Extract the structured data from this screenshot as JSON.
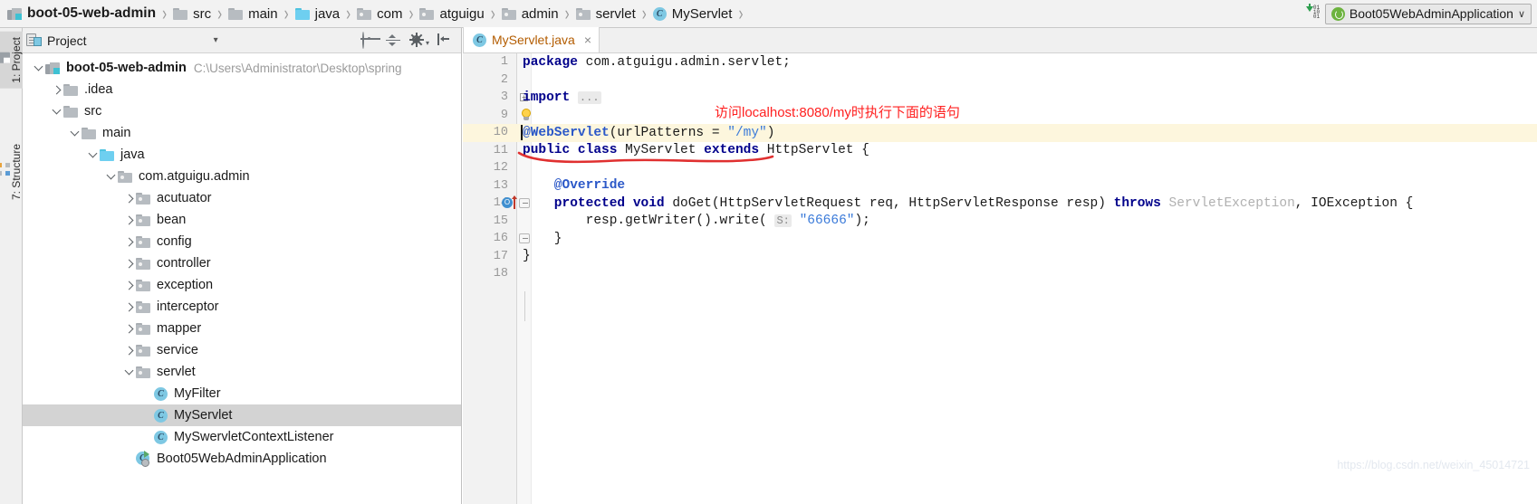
{
  "navbar": {
    "breadcrumbs": [
      {
        "label": "boot-05-web-admin",
        "icon": "module-icon",
        "kind": "module"
      },
      {
        "label": "src",
        "icon": "folder-icon",
        "kind": "folder"
      },
      {
        "label": "main",
        "icon": "folder-icon",
        "kind": "folder"
      },
      {
        "label": "java",
        "icon": "source-folder-icon",
        "kind": "source"
      },
      {
        "label": "com",
        "icon": "package-icon",
        "kind": "package"
      },
      {
        "label": "atguigu",
        "icon": "package-icon",
        "kind": "package"
      },
      {
        "label": "admin",
        "icon": "package-icon",
        "kind": "package"
      },
      {
        "label": "servlet",
        "icon": "package-icon",
        "kind": "package"
      },
      {
        "label": "MyServlet",
        "icon": "java-class-icon",
        "kind": "class"
      }
    ],
    "separator": "›",
    "update_icon": "download-update-icon",
    "run_config": {
      "label": "Boot05WebAdminApplication",
      "icon": "spring-boot-icon",
      "caret": "∨"
    }
  },
  "stripe": {
    "tabs": [
      {
        "label": "1: Project",
        "icon": "project-icon",
        "active": true
      },
      {
        "label": "7: Structure",
        "icon": "structure-icon",
        "active": false
      }
    ]
  },
  "project_panel": {
    "title": "Project",
    "title_icon": "project-view-icon",
    "dropdown_caret": "▾",
    "actions": [
      {
        "name": "locate-icon",
        "label": "Select Opened File"
      },
      {
        "name": "collapse-all-icon",
        "label": "Collapse All"
      },
      {
        "name": "settings-gear-icon",
        "label": "Settings"
      },
      {
        "name": "hide-panel-icon",
        "label": "Hide"
      }
    ],
    "tree": [
      {
        "label": "boot-05-web-admin",
        "path": "C:\\Users\\Administrator\\Desktop\\spring",
        "indent": 0,
        "twisty": "down",
        "icon": "module-icon",
        "bold": true,
        "selected": false
      },
      {
        "label": ".idea",
        "indent": 1,
        "twisty": "right",
        "icon": "folder-icon",
        "selected": false
      },
      {
        "label": "src",
        "indent": 1,
        "twisty": "down",
        "icon": "folder-icon",
        "selected": false
      },
      {
        "label": "main",
        "indent": 2,
        "twisty": "down",
        "icon": "folder-icon",
        "selected": false
      },
      {
        "label": "java",
        "indent": 3,
        "twisty": "down",
        "icon": "source-folder-icon",
        "selected": false
      },
      {
        "label": "com.atguigu.admin",
        "indent": 4,
        "twisty": "down",
        "icon": "package-icon",
        "selected": false
      },
      {
        "label": "acutuator",
        "indent": 5,
        "twisty": "right",
        "icon": "package-icon",
        "selected": false
      },
      {
        "label": "bean",
        "indent": 5,
        "twisty": "right",
        "icon": "package-icon",
        "selected": false
      },
      {
        "label": "config",
        "indent": 5,
        "twisty": "right",
        "icon": "package-icon",
        "selected": false
      },
      {
        "label": "controller",
        "indent": 5,
        "twisty": "right",
        "icon": "package-icon",
        "selected": false
      },
      {
        "label": "exception",
        "indent": 5,
        "twisty": "right",
        "icon": "package-icon",
        "selected": false
      },
      {
        "label": "interceptor",
        "indent": 5,
        "twisty": "right",
        "icon": "package-icon",
        "selected": false
      },
      {
        "label": "mapper",
        "indent": 5,
        "twisty": "right",
        "icon": "package-icon",
        "selected": false
      },
      {
        "label": "service",
        "indent": 5,
        "twisty": "right",
        "icon": "package-icon",
        "selected": false
      },
      {
        "label": "servlet",
        "indent": 5,
        "twisty": "down",
        "icon": "package-icon",
        "selected": false
      },
      {
        "label": "MyFilter",
        "indent": 6,
        "twisty": "none",
        "icon": "java-class-icon",
        "selected": false
      },
      {
        "label": "MyServlet",
        "indent": 6,
        "twisty": "none",
        "icon": "java-class-icon",
        "selected": true
      },
      {
        "label": "MySwervletContextListener",
        "indent": 6,
        "twisty": "none",
        "icon": "java-class-icon",
        "selected": false
      },
      {
        "label": "Boot05WebAdminApplication",
        "indent": 5,
        "twisty": "none",
        "icon": "runnable-class-icon",
        "selected": false
      }
    ]
  },
  "editor": {
    "tab": {
      "label": "MyServlet.java",
      "icon": "java-class-icon",
      "close": "×"
    },
    "lines": [
      {
        "no": "1",
        "segments": [
          {
            "t": "package",
            "c": "kw"
          },
          {
            "t": " com.atguigu.admin.servlet;",
            "c": ""
          }
        ]
      },
      {
        "no": "2",
        "segments": []
      },
      {
        "no": "3",
        "segments": [
          {
            "t": "import",
            "c": "kw"
          },
          {
            "t": " ",
            "c": ""
          },
          {
            "t": "...",
            "c": "hint"
          }
        ],
        "fold": "plus"
      },
      {
        "no": "9",
        "segments": [],
        "bulb": true
      },
      {
        "no": "10",
        "segments": [
          {
            "t": "@WebServlet",
            "c": "anno-blue"
          },
          {
            "t": "(urlPatterns = ",
            "c": ""
          },
          {
            "t": "\"/my\"",
            "c": "str"
          },
          {
            "t": ")",
            "c": ""
          }
        ],
        "highlight": true,
        "caret": true
      },
      {
        "no": "11",
        "segments": [
          {
            "t": "public class",
            "c": "kw"
          },
          {
            "t": " MyServlet ",
            "c": ""
          },
          {
            "t": "extends",
            "c": "kw"
          },
          {
            "t": " HttpServlet {",
            "c": ""
          }
        ]
      },
      {
        "no": "12",
        "segments": []
      },
      {
        "no": "13",
        "segments": [
          {
            "t": "    @Override",
            "c": "anno-blue"
          }
        ]
      },
      {
        "no": "14",
        "segments": [
          {
            "t": "    protected void",
            "c": "kw"
          },
          {
            "t": " doGet(HttpServletRequest req, HttpServletResponse resp) ",
            "c": ""
          },
          {
            "t": "throws",
            "c": "kw"
          },
          {
            "t": " ",
            "c": ""
          },
          {
            "t": "ServletException",
            "c": "gray"
          },
          {
            "t": ", IOException {",
            "c": ""
          }
        ],
        "override": true,
        "fold": "brace-open"
      },
      {
        "no": "15",
        "segments": [
          {
            "t": "        resp.getWriter().write( ",
            "c": ""
          },
          {
            "t": "S:",
            "c": "hint"
          },
          {
            "t": " ",
            "c": ""
          },
          {
            "t": "\"66666\"",
            "c": "str"
          },
          {
            "t": ");",
            "c": ""
          }
        ]
      },
      {
        "no": "16",
        "segments": [
          {
            "t": "    }",
            "c": ""
          }
        ],
        "fold": "brace-close"
      },
      {
        "no": "17",
        "segments": [
          {
            "t": "}",
            "c": ""
          }
        ]
      },
      {
        "no": "18",
        "segments": []
      }
    ],
    "annotations": {
      "note_text": "访问localhost:8080/my时执行下面的语句",
      "note_color": "#ff2020",
      "underline_color": "#e03030"
    },
    "watermark": "https://blog.csdn.net/weixin_45014721"
  },
  "colors": {
    "selection": "#d3d3d3",
    "line_highlight": "#fdf6dd",
    "keyword": "#00008b",
    "string": "#3a7ad9",
    "annotation": "#2b58c8",
    "tab_text": "#b35c00",
    "accent_green": "#6db33f"
  }
}
